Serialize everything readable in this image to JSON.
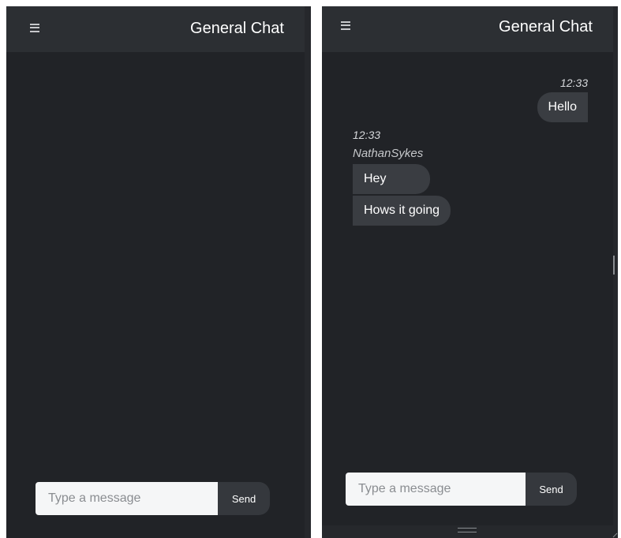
{
  "chat_title": "General Chat",
  "composer": {
    "placeholder": "Type a message",
    "send_label": "Send"
  },
  "messages": [
    {
      "time": "12:33",
      "sender": "",
      "own": true,
      "lines": [
        "Hello"
      ]
    },
    {
      "time": "12:33",
      "sender": "NathanSykes",
      "own": false,
      "lines": [
        "Hey",
        "Hows it going"
      ]
    }
  ],
  "icons": {
    "menu": "hamburger-menu-icon"
  },
  "colors": {
    "background": "#212327",
    "header": "#2c2f33",
    "bubble": "#3a3d42",
    "input": "#f5f6f7",
    "send_button": "#35383d"
  }
}
